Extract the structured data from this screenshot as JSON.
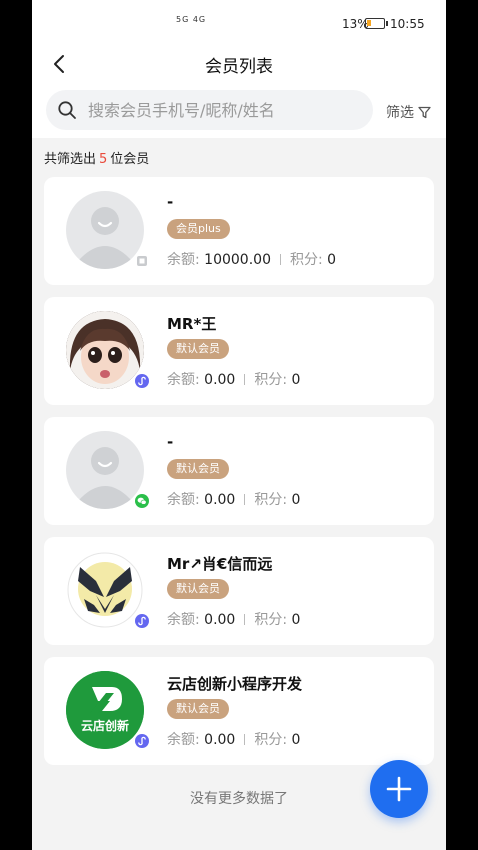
{
  "status_bar": {
    "network": "5G 4G",
    "battery": "13%",
    "time": "10:55"
  },
  "header": {
    "title": "会员列表"
  },
  "search": {
    "placeholder": "搜索会员手机号/昵称/姓名",
    "filter_label": "筛选"
  },
  "summary": {
    "prefix": "共筛选出",
    "count": "5",
    "suffix": "位会员"
  },
  "labels": {
    "balance": "余额:",
    "points": "积分:"
  },
  "members": [
    {
      "name": "-",
      "tag": "会员plus",
      "balance": "10000.00",
      "points": "0",
      "avatar": "default",
      "source_icon": "grid-icon"
    },
    {
      "name": "MR*王",
      "tag": "默认会员",
      "balance": "0.00",
      "points": "0",
      "avatar": "cartoon-girl",
      "source_icon": "miniprogram-icon"
    },
    {
      "name": "-",
      "tag": "默认会员",
      "balance": "0.00",
      "points": "0",
      "avatar": "default",
      "source_icon": "wechat-icon"
    },
    {
      "name": "Mr↗肖€信而远",
      "tag": "默认会员",
      "balance": "0.00",
      "points": "0",
      "avatar": "heart-hands",
      "source_icon": "miniprogram-icon"
    },
    {
      "name": "云店创新小程序开发",
      "tag": "默认会员",
      "balance": "0.00",
      "points": "0",
      "avatar": "brand-logo",
      "avatar_text": "云店创新",
      "source_icon": "miniprogram-icon"
    }
  ],
  "footer": {
    "no_more": "没有更多数据了"
  },
  "colors": {
    "primary": "#1f6ef0",
    "tag": "#c9a27e",
    "count": "#e94a3b"
  }
}
